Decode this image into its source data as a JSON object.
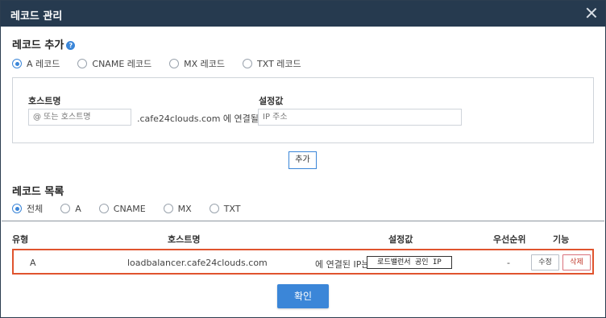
{
  "dialog": {
    "title": "레코드 관리"
  },
  "add_section": {
    "title": "레코드 추가",
    "record_types": [
      {
        "label": "A 레코드",
        "checked": true
      },
      {
        "label": "CNAME 레코드",
        "checked": false
      },
      {
        "label": "MX 레코드",
        "checked": false
      },
      {
        "label": "TXT 레코드",
        "checked": false
      }
    ],
    "hostname_label": "호스트명",
    "hostname_placeholder": "@ 또는 호스트명",
    "domain_suffix": ".cafe24clouds.com 에 연결될 IP는",
    "value_label": "설정값",
    "value_placeholder": "IP 주소",
    "add_button": "추가"
  },
  "list_section": {
    "title": "레코드 목록",
    "filters": [
      {
        "label": "전체",
        "checked": true
      },
      {
        "label": "A",
        "checked": false
      },
      {
        "label": "CNAME",
        "checked": false
      },
      {
        "label": "MX",
        "checked": false
      },
      {
        "label": "TXT",
        "checked": false
      }
    ],
    "columns": {
      "type": "유형",
      "hostname": "호스트명",
      "value": "설정값",
      "priority": "우선순위",
      "function": "기능"
    },
    "rows": [
      {
        "type": "A",
        "hostname": "loadbalancer.cafe24clouds.com",
        "connected_text": "에 연결된 IP는",
        "value": "로드밸런서 공인 IP",
        "priority": "-",
        "edit_label": "수정",
        "delete_label": "삭제"
      }
    ]
  },
  "confirm_button": "확인",
  "colors": {
    "titlebar": "#263a4f",
    "accent": "#3b86d8",
    "highlight": "#e0542e"
  }
}
